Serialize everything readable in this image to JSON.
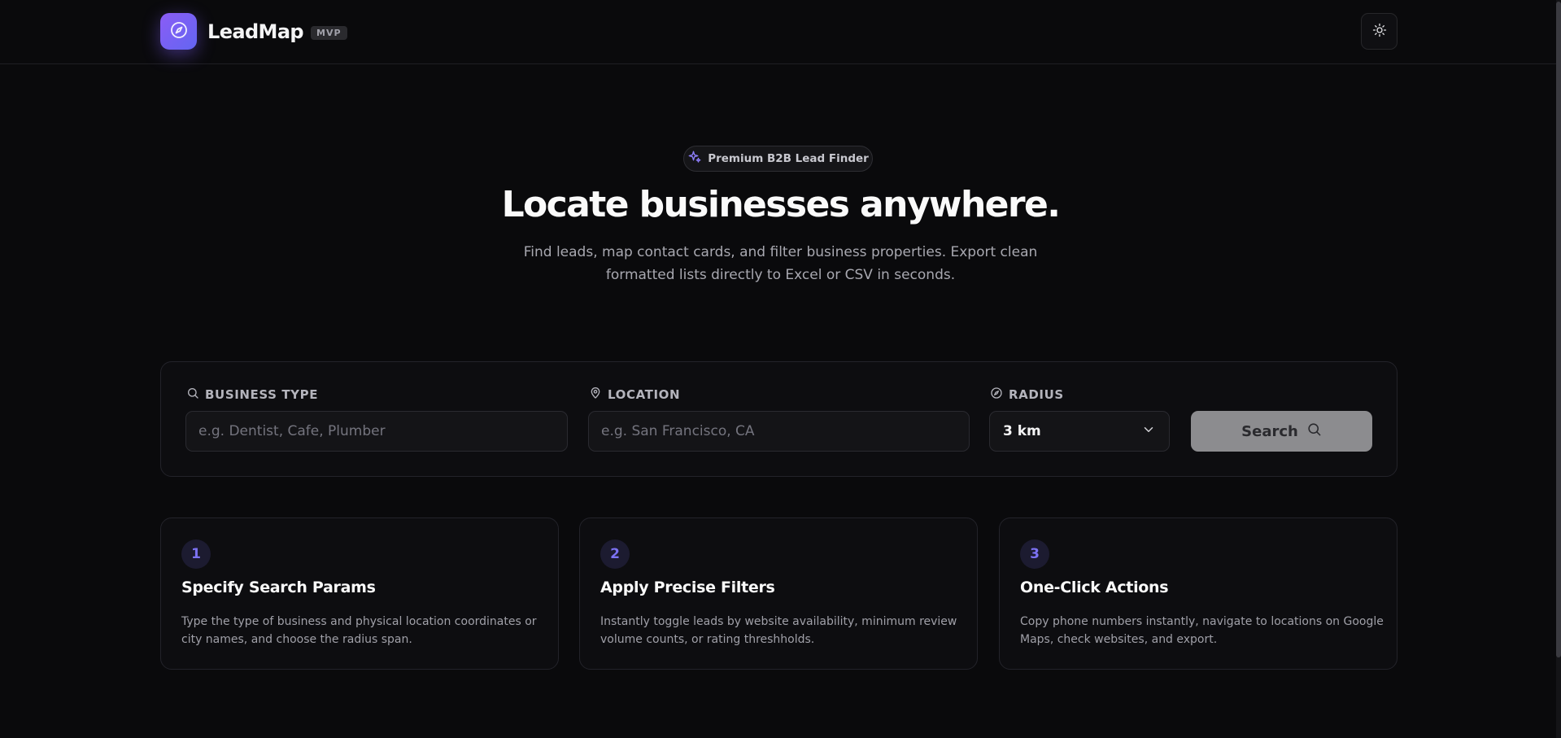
{
  "header": {
    "brand_name": "LeadMap",
    "brand_badge": "MVP",
    "logo_icon": "compass-icon",
    "theme_toggle_icon": "sun-icon"
  },
  "hero": {
    "badge": "Premium B2B Lead Finder",
    "badge_icon": "sparkles-icon",
    "title": "Locate businesses anywhere.",
    "subtitle": "Find leads, map contact cards, and filter business properties. Export clean formatted lists directly to Excel or CSV in seconds."
  },
  "search": {
    "business_type": {
      "label": "BUSINESS TYPE",
      "placeholder": "e.g. Dentist, Cafe, Plumber",
      "value": "",
      "icon": "search-icon"
    },
    "location": {
      "label": "LOCATION",
      "placeholder": "e.g. San Francisco, CA",
      "value": "",
      "icon": "map-pin-icon"
    },
    "radius": {
      "label": "RADIUS",
      "selected": "3 km",
      "icon": "compass-icon"
    },
    "button_label": "Search"
  },
  "steps": [
    {
      "number": "1",
      "title": "Specify Search Params",
      "description": "Type the type of business and physical location coordinates or city names, and choose the radius span."
    },
    {
      "number": "2",
      "title": "Apply Precise Filters",
      "description": "Instantly toggle leads by website availability, minimum review volume counts, or rating threshholds."
    },
    {
      "number": "3",
      "title": "One-Click Actions",
      "description": "Copy phone numbers instantly, navigate to locations on Google Maps, check websites, and export."
    }
  ],
  "colors": {
    "background": "#0a0a0c",
    "accent": "#7c5cf6",
    "accent_secondary": "#6366f1",
    "search_button": "#8c8c8f"
  }
}
